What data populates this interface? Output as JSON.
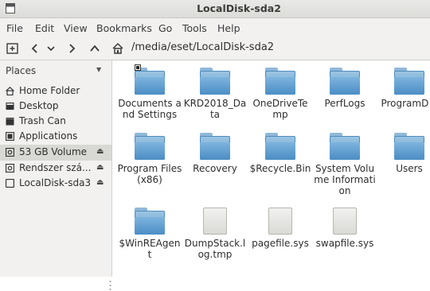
{
  "window": {
    "title": "LocalDisk-sda2"
  },
  "menubar": {
    "items": [
      "File",
      "Edit",
      "View",
      "Bookmarks",
      "Go",
      "Tools",
      "Help"
    ]
  },
  "toolbar": {
    "location": "/media/eset/LocalDisk-sda2"
  },
  "sidebar": {
    "header": "Places",
    "items": [
      {
        "label": "Home Folder",
        "icon": "home-icon"
      },
      {
        "label": "Desktop",
        "icon": "desktop-icon"
      },
      {
        "label": "Trash Can",
        "icon": "trash-icon"
      },
      {
        "label": "Applications",
        "icon": "applications-icon"
      },
      {
        "label": "53 GB Volume",
        "icon": "drive-icon",
        "eject": true,
        "selected": true
      },
      {
        "label": "Rendszer szá...",
        "icon": "drive-icon",
        "eject": true
      },
      {
        "label": "LocalDisk-sda3",
        "icon": "drive-icon",
        "eject": true
      }
    ]
  },
  "files": [
    {
      "label": "Documents and Settings",
      "type": "folder",
      "badge": true
    },
    {
      "label": "KRD2018_Da ta",
      "type": "folder"
    },
    {
      "label": "OneDriveTe mp",
      "type": "folder"
    },
    {
      "label": "PerfLogs",
      "type": "folder"
    },
    {
      "label": "ProgramD a",
      "type": "folder"
    },
    {
      "label": "Program Files (x86)",
      "type": "folder"
    },
    {
      "label": "Recovery",
      "type": "folder"
    },
    {
      "label": "$Recycle.Bin",
      "type": "folder"
    },
    {
      "label": "System Volume Information",
      "type": "folder"
    },
    {
      "label": "Users",
      "type": "folder"
    },
    {
      "label": "$WinREAgen t",
      "type": "folder"
    },
    {
      "label": "DumpStack.l og.tmp",
      "type": "file"
    },
    {
      "label": "pagefile.sys",
      "type": "file"
    },
    {
      "label": "swapfile.sys",
      "type": "file"
    }
  ]
}
